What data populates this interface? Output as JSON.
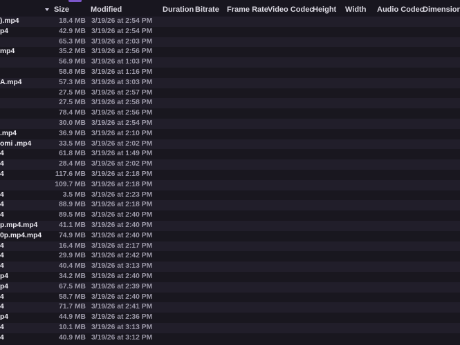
{
  "header": {
    "columns": [
      "Size",
      "Modified",
      "Duration",
      "Bitrate",
      "Frame Rate",
      "Video Codec",
      "Height",
      "Width",
      "Audio Codec",
      "Dimensions"
    ],
    "sort_indicator": "sort-descending-icon"
  },
  "rows": [
    {
      "name": ").mp4",
      "size": "18.4 MB",
      "modified": "3/19/26 at 2:54 PM"
    },
    {
      "name": "p4",
      "size": "42.9 MB",
      "modified": "3/19/26 at 2:54 PM"
    },
    {
      "name": "",
      "size": "65.3 MB",
      "modified": "3/19/26 at 2:03 PM"
    },
    {
      "name": "mp4",
      "size": "35.2 MB",
      "modified": "3/19/26 at 2:56 PM"
    },
    {
      "name": "",
      "size": "56.9 MB",
      "modified": "3/19/26 at 1:03 PM"
    },
    {
      "name": "",
      "size": "58.8 MB",
      "modified": "3/19/26 at 1:16 PM"
    },
    {
      "name": "A.mp4",
      "size": "57.3 MB",
      "modified": "3/19/26 at 3:03 PM"
    },
    {
      "name": "",
      "size": "27.5 MB",
      "modified": "3/19/26 at 2:57 PM"
    },
    {
      "name": "",
      "size": "27.5 MB",
      "modified": "3/19/26 at 2:58 PM"
    },
    {
      "name": "",
      "size": "78.4 MB",
      "modified": "3/19/26 at 2:56 PM"
    },
    {
      "name": "",
      "size": "30.0 MB",
      "modified": "3/19/26 at 2:54 PM"
    },
    {
      "name": ".mp4",
      "size": "36.9 MB",
      "modified": "3/19/26 at 2:10 PM"
    },
    {
      "name": "omi .mp4",
      "size": "33.5 MB",
      "modified": "3/19/26 at 2:02 PM"
    },
    {
      "name": "4",
      "size": "61.8 MB",
      "modified": "3/19/26 at 1:49 PM"
    },
    {
      "name": "4",
      "size": "28.4 MB",
      "modified": "3/19/26 at 2:02 PM"
    },
    {
      "name": "4",
      "size": "117.6 MB",
      "modified": "3/19/26 at 2:18 PM"
    },
    {
      "name": "",
      "size": "109.7 MB",
      "modified": "3/19/26 at 2:18 PM"
    },
    {
      "name": "4",
      "size": "3.5 MB",
      "modified": "3/19/26 at 2:23 PM"
    },
    {
      "name": "4",
      "size": "88.9 MB",
      "modified": "3/19/26 at 2:18 PM"
    },
    {
      "name": "4",
      "size": "89.5 MB",
      "modified": "3/19/26 at 2:40 PM"
    },
    {
      "name": "p.mp4.mp4",
      "size": "41.1 MB",
      "modified": "3/19/26 at 2:40 PM"
    },
    {
      "name": "0p.mp4.mp4",
      "size": "74.9 MB",
      "modified": "3/19/26 at 2:40 PM"
    },
    {
      "name": "4",
      "size": "16.4 MB",
      "modified": "3/19/26 at 2:17 PM"
    },
    {
      "name": "4",
      "size": "29.9 MB",
      "modified": "3/19/26 at 2:42 PM"
    },
    {
      "name": "4",
      "size": "40.4 MB",
      "modified": "3/19/26 at 3:13 PM"
    },
    {
      "name": "p4",
      "size": "34.2 MB",
      "modified": "3/19/26 at 2:40 PM"
    },
    {
      "name": "p4",
      "size": "67.5 MB",
      "modified": "3/19/26 at 2:39 PM"
    },
    {
      "name": "4",
      "size": "58.7 MB",
      "modified": "3/19/26 at 2:40 PM"
    },
    {
      "name": "4",
      "size": "71.7 MB",
      "modified": "3/19/26 at 2:41 PM"
    },
    {
      "name": "p4",
      "size": "44.9 MB",
      "modified": "3/19/26 at 2:36 PM"
    },
    {
      "name": "4",
      "size": "10.1 MB",
      "modified": "3/19/26 at 3:13 PM"
    },
    {
      "name": "4",
      "size": "40.9 MB",
      "modified": "3/19/26 at 3:12 PM"
    }
  ]
}
